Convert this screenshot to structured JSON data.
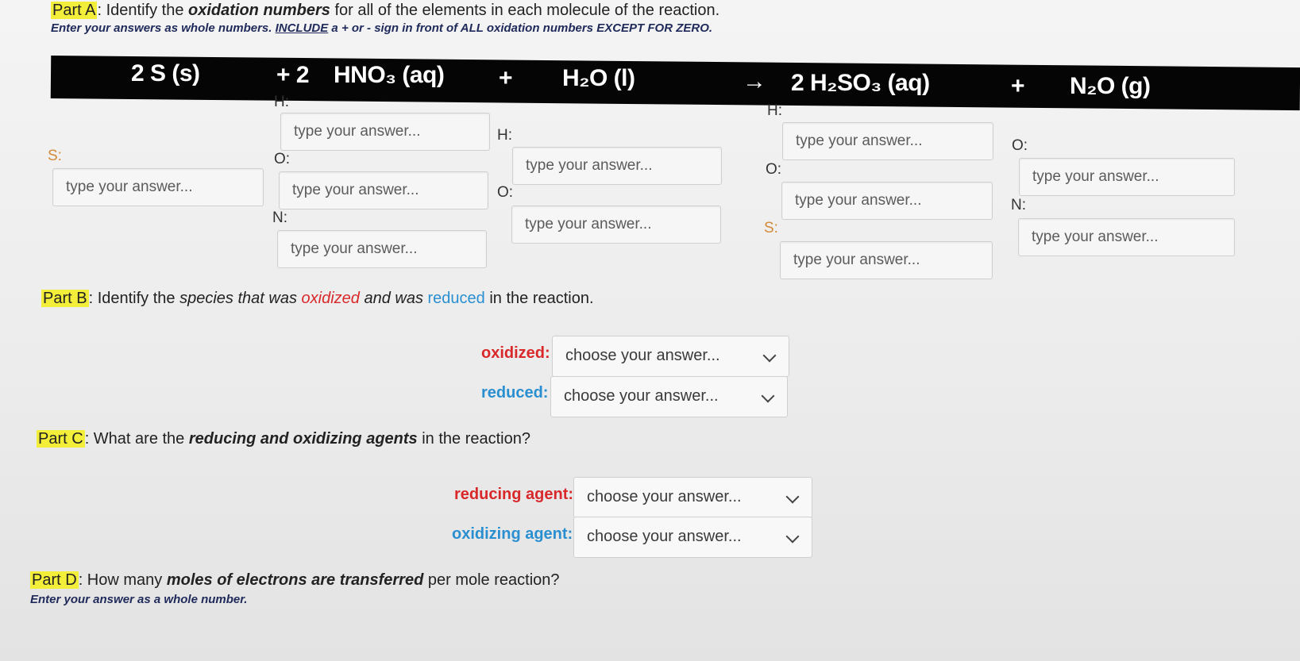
{
  "part_a": {
    "tag": "Part A",
    "text_1": ": Identify the ",
    "text_bold": "oxidation numbers",
    "text_2": " for all of the elements in each molecule of the reaction.",
    "note_1": "Enter your answers as whole numbers. ",
    "note_link": "INCLUDE",
    "note_2": " a + or - sign in front of ALL oxidation numbers EXCEPT FOR ZERO."
  },
  "equation": {
    "s": "2 S (s)",
    "plus_2": "+ 2",
    "hno3": "HNO₃ (aq)",
    "plus_a": "+",
    "h2o": "H₂O (l)",
    "arrow": "→",
    "h2so3": "2 H₂SO₃ (aq)",
    "plus_b": "+",
    "n2o": "N₂O (g)"
  },
  "placeholder": "type your answer...",
  "labels": {
    "s": "S:",
    "h": "H:",
    "o": "O:",
    "n": "N:"
  },
  "part_b": {
    "tag": "Part B",
    "text_1": ": Identify the ",
    "text_italic": "species that was ",
    "oxidized": "oxidized",
    "and": " and was ",
    "reduced": "reduced",
    "text_2": " in the reaction.",
    "oxidized_label": "oxidized:",
    "reduced_label": "reduced:",
    "select_value": "choose your answer..."
  },
  "part_c": {
    "tag": "Part C",
    "text_1": ": What are the ",
    "text_italic": "reducing and oxidizing agents",
    "text_2": " in the reaction?",
    "reducing_label": "reducing agent:",
    "oxidizing_label": "oxidizing agent:",
    "select_value": "choose your answer..."
  },
  "part_d": {
    "tag": "Part D",
    "text_1": ": How many ",
    "text_italic": "moles of electrons are transferred",
    "text_2": " per mole reaction?",
    "note": "Enter your answer as a whole number."
  },
  "colors": {
    "highlight": "#f3ee3a",
    "red": "#d9282a",
    "blue": "#2a8fd0",
    "bar": "#050505"
  }
}
